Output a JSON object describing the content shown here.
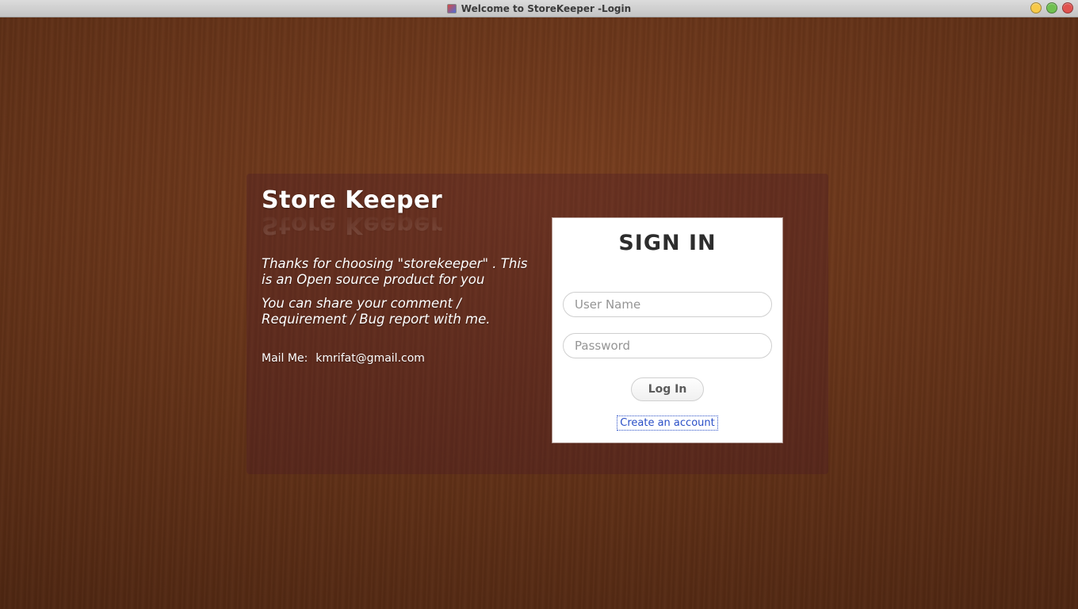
{
  "window": {
    "title": "Welcome to StoreKeeper -Login"
  },
  "left": {
    "app_name": "Store Keeper",
    "blurb1": "Thanks for choosing \"storekeeper\" . This is an Open source product for you",
    "blurb2": "You can share your comment / Requirement / Bug report with me.",
    "mail_label": "Mail Me:",
    "mail_value": "kmrifat@gmail.com"
  },
  "signin": {
    "heading": "SIGN IN",
    "username_placeholder": "User Name",
    "password_placeholder": "Password",
    "login_label": "Log In",
    "create_link_label": "Create an account"
  }
}
